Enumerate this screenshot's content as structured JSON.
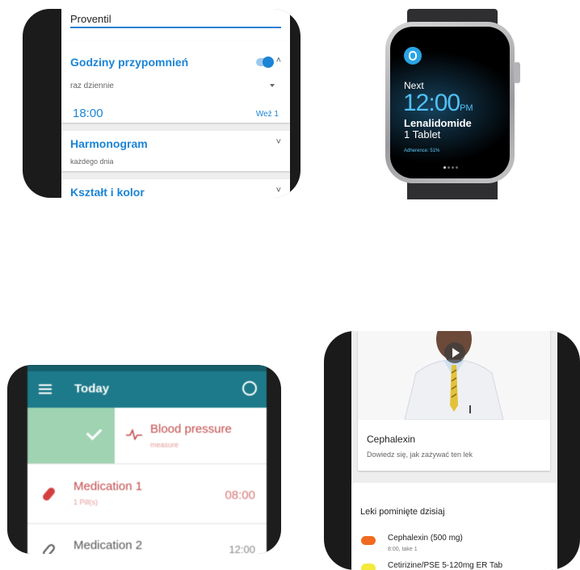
{
  "panel_settings": {
    "name_value": "Proventil",
    "reminder": {
      "title": "Godziny przypomnień",
      "frequency": "raz dziennie",
      "time": "18:00",
      "take_label": "Weź 1",
      "toggle_on": true
    },
    "schedule": {
      "title": "Harmonogram",
      "value": "każdego dnia"
    },
    "shape": {
      "title": "Kształt i kolor"
    },
    "colors": {
      "accent": "#1b84d6"
    }
  },
  "panel_watch": {
    "next_label": "Next",
    "time": "12:00",
    "ampm": "PM",
    "drug": "Lenalidomide",
    "quantity": "1 Tablet",
    "adherence": "Adherence: 51%",
    "accent": "#4fc1f4"
  },
  "panel_today": {
    "title": "Today",
    "rows": [
      {
        "name": "Blood pressure",
        "sub": "measure",
        "time": ""
      },
      {
        "name": "Medication 1",
        "sub": "1 Pill(s)",
        "time": "08:00"
      },
      {
        "name": "Medication 2",
        "sub": "",
        "time": "12:00"
      }
    ],
    "bar_color": "#1d7a8a"
  },
  "panel_missed": {
    "video_title": "Cephalexin",
    "video_sub": "Dowiedz się, jak zażywać ten lek",
    "missed_header": "Leki pominięte dzisiaj",
    "items": [
      {
        "name": "Cephalexin (500 mg)",
        "detail": "8:00, take 1",
        "color": "#f06a1f"
      },
      {
        "name": "Cetirizine/PSE 5-120mg ER Tab",
        "detail": "",
        "color": "#f3ea3a"
      }
    ]
  }
}
